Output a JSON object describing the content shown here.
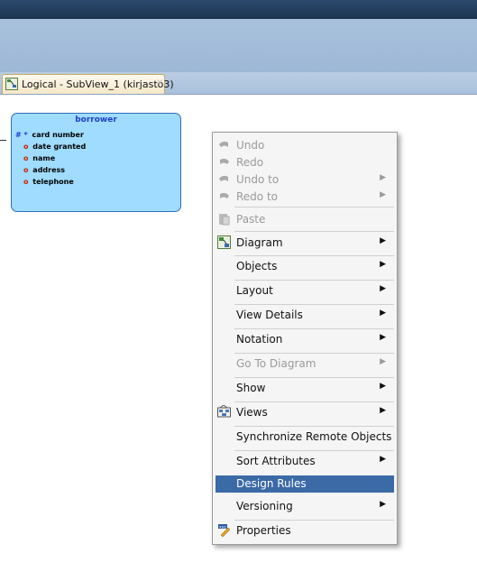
{
  "tab": {
    "label": "Logical - SubView_1 (kirjasto3)",
    "close": "×"
  },
  "entity": {
    "title": "borrower",
    "attributes": [
      {
        "marker": "# *",
        "name": "card number"
      },
      {
        "marker": "o",
        "name": "date granted"
      },
      {
        "marker": "o",
        "name": "name"
      },
      {
        "marker": "o",
        "name": "address"
      },
      {
        "marker": "o",
        "name": "telephone"
      }
    ]
  },
  "context_menu": {
    "items": [
      {
        "label": "Undo",
        "icon": "undo-icon",
        "enabled": false
      },
      {
        "label": "Redo",
        "icon": "redo-icon",
        "enabled": false
      },
      {
        "label": "Undo to",
        "icon": "undo-icon",
        "enabled": false,
        "submenu": true
      },
      {
        "label": "Redo to",
        "icon": "redo-icon",
        "enabled": false,
        "submenu": true
      },
      {
        "label": "Paste",
        "icon": "paste-icon",
        "enabled": false
      },
      {
        "label": "Diagram",
        "icon": "diagram-icon",
        "enabled": true,
        "submenu": true
      },
      {
        "label": "Objects",
        "enabled": true,
        "submenu": true
      },
      {
        "label": "Layout",
        "enabled": true,
        "submenu": true
      },
      {
        "label": "View Details",
        "enabled": true,
        "submenu": true
      },
      {
        "label": "Notation",
        "enabled": true,
        "submenu": true
      },
      {
        "label": "Go To Diagram",
        "enabled": false,
        "submenu": true
      },
      {
        "label": "Show",
        "enabled": true,
        "submenu": true
      },
      {
        "label": "Views",
        "icon": "views-icon",
        "enabled": true,
        "submenu": true
      },
      {
        "label": "Synchronize Remote Objects",
        "enabled": true
      },
      {
        "label": "Sort Attributes",
        "enabled": true,
        "submenu": true
      },
      {
        "label": "Design Rules",
        "enabled": true,
        "highlighted": true
      },
      {
        "label": "Versioning",
        "enabled": true,
        "submenu": true
      },
      {
        "label": "Properties",
        "icon": "properties-icon",
        "enabled": true
      }
    ]
  },
  "colors": {
    "entity_fill": "#9fdcff",
    "entity_border": "#2f6fc0",
    "menu_highlight": "#3b6aa7",
    "toolbar": "#a9c1dc"
  }
}
